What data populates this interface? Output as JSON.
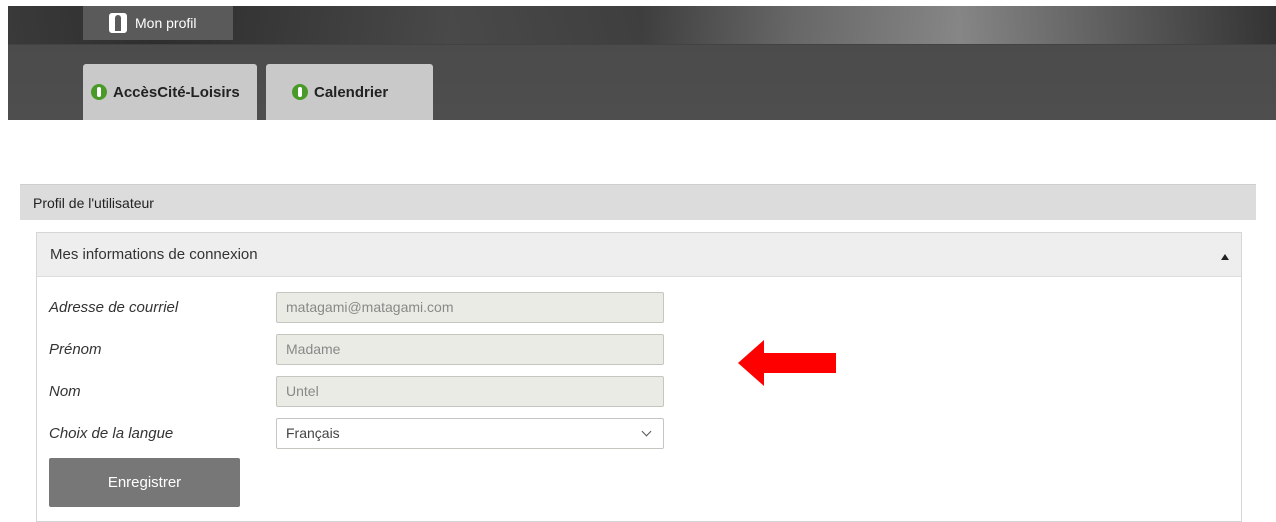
{
  "header": {
    "profile_tab": "Mon profil",
    "tabs": [
      {
        "label": "AccèsCité-Loisirs"
      },
      {
        "label": "Calendrier"
      }
    ]
  },
  "section": {
    "title": "Profil de l'utilisateur"
  },
  "panel": {
    "title": "Mes informations de connexion",
    "fields": {
      "email": {
        "label": "Adresse de courriel",
        "value": "matagami@matagami.com"
      },
      "first_name": {
        "label": "Prénom",
        "value": "Madame"
      },
      "last_name": {
        "label": "Nom",
        "value": "Untel"
      },
      "language": {
        "label": "Choix de la langue",
        "value": "Français"
      }
    },
    "save_label": "Enregistrer"
  },
  "colors": {
    "accent_green": "#4a9a2a",
    "annotation_arrow": "#ff0000",
    "button_gray": "#777777"
  }
}
